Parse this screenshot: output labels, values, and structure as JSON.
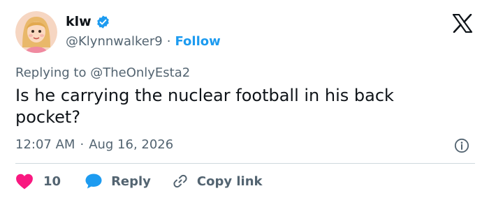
{
  "user": {
    "name": "klw",
    "handle": "@Klynnwalker9",
    "separator": "·",
    "follow_label": "Follow"
  },
  "reply_to": {
    "prefix": "Replying to",
    "mention": "@TheOnlyEsta2"
  },
  "tweet": {
    "text": "Is he carrying the nuclear football in his back pocket?",
    "time": "12:07 AM",
    "separator": "·",
    "date": "Aug 16, 2026"
  },
  "actions": {
    "like_count": "10",
    "reply_label": "Reply",
    "copy_label": "Copy link"
  },
  "icons": {
    "verified": "verified-badge-icon",
    "x_logo": "x-logo-icon",
    "info": "info-icon",
    "heart": "heart-icon",
    "reply": "speech-bubble-icon",
    "copy": "link-icon"
  },
  "colors": {
    "text": "#0f1419",
    "secondary": "#536471",
    "accent": "#1d9bf0",
    "heart": "#f91880",
    "divider": "#cfd9de"
  }
}
